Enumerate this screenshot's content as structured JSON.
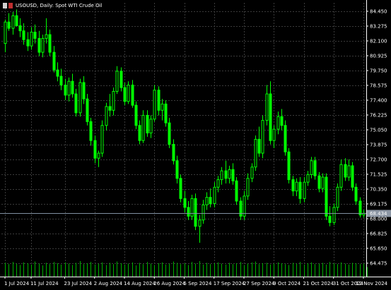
{
  "window": {
    "title": "USOUSD, Daily:  Spot WTI Crude Oil",
    "icon": "chart-window-icon"
  },
  "colors": {
    "background": "#000000",
    "grid": "#3a3a3a",
    "candle": "#00ff00",
    "volume": "#00b000",
    "axis_text": "#ffffff",
    "price_line": "#8090a0",
    "price_tag_bg": "#8c96a4",
    "price_tag_text": "#ffffff"
  },
  "chart_data": {
    "type": "candlestick",
    "symbol": "USOUSD",
    "timeframe": "Daily",
    "title": "USOUSD, Daily:  Spot WTI Crude Oil",
    "grid": true,
    "ylim": [
      63.8,
      85.2
    ],
    "y_ticks": [
      "84.450",
      "83.275",
      "82.100",
      "80.925",
      "79.750",
      "78.575",
      "77.400",
      "76.225",
      "75.050",
      "73.875",
      "72.700",
      "71.525",
      "70.350",
      "69.175",
      "68.000",
      "66.825",
      "65.650",
      "64.475"
    ],
    "x_ticks": [
      "1 Jul 2024",
      "11 Jul 2024",
      "23 Jul 2024",
      "2 Aug 2024",
      "14 Aug 2024",
      "26 Aug 2024",
      "5 Sep 2024",
      "17 Sep 2024",
      "27 Sep 2024",
      "9 Oct 2024",
      "21 Oct 2024",
      "31 Oct 2024",
      "12 Nov 2024"
    ],
    "x_tick_bar_index": [
      0,
      7,
      16,
      24,
      32,
      40,
      48,
      56,
      64,
      72,
      80,
      88,
      96
    ],
    "current_price": "68.434",
    "current_price_value": 68.434,
    "candles": [
      [
        81.9,
        83.8,
        81.2,
        83.6
      ],
      [
        83.6,
        84.3,
        82.9,
        83.1
      ],
      [
        83.1,
        84.4,
        82.6,
        84.1
      ],
      [
        84.1,
        84.6,
        83.4,
        83.3
      ],
      [
        83.3,
        83.9,
        82.4,
        82.9
      ],
      [
        82.9,
        83.5,
        81.8,
        82.2
      ],
      [
        82.2,
        82.8,
        81.3,
        81.7
      ],
      [
        81.7,
        83.2,
        81.4,
        82.8
      ],
      [
        82.8,
        83.4,
        81.9,
        82.3
      ],
      [
        82.3,
        82.9,
        80.9,
        81.2
      ],
      [
        81.2,
        82.6,
        80.8,
        82.3
      ],
      [
        82.3,
        83.9,
        81.9,
        82.6
      ],
      [
        82.6,
        83.0,
        80.9,
        81.2
      ],
      [
        81.2,
        81.7,
        79.6,
        79.8
      ],
      [
        79.8,
        80.4,
        78.9,
        79.3
      ],
      [
        79.3,
        79.9,
        78.2,
        78.6
      ],
      [
        78.6,
        79.1,
        77.4,
        77.8
      ],
      [
        77.8,
        79.2,
        77.3,
        78.9
      ],
      [
        78.9,
        79.5,
        77.6,
        77.9
      ],
      [
        77.9,
        78.3,
        76.1,
        76.4
      ],
      [
        76.4,
        79.1,
        76.1,
        78.8
      ],
      [
        78.8,
        79.3,
        77.1,
        77.5
      ],
      [
        77.5,
        77.9,
        75.4,
        75.7
      ],
      [
        75.7,
        76.0,
        73.8,
        74.2
      ],
      [
        74.2,
        74.6,
        72.4,
        72.8
      ],
      [
        72.8,
        73.4,
        72.1,
        73.2
      ],
      [
        73.2,
        75.8,
        72.9,
        75.4
      ],
      [
        75.4,
        77.2,
        75.0,
        76.9
      ],
      [
        76.9,
        77.9,
        76.1,
        76.6
      ],
      [
        76.6,
        78.4,
        76.2,
        78.1
      ],
      [
        78.1,
        80.1,
        77.9,
        79.7
      ],
      [
        79.7,
        80.0,
        78.1,
        78.4
      ],
      [
        78.4,
        78.8,
        77.0,
        77.3
      ],
      [
        77.3,
        78.9,
        77.1,
        78.6
      ],
      [
        78.6,
        79.0,
        76.8,
        77.0
      ],
      [
        77.0,
        77.3,
        75.1,
        75.4
      ],
      [
        75.4,
        75.8,
        73.9,
        74.2
      ],
      [
        74.2,
        76.6,
        74.0,
        76.2
      ],
      [
        76.2,
        76.6,
        74.5,
        74.8
      ],
      [
        74.8,
        76.2,
        74.4,
        75.9
      ],
      [
        75.9,
        78.6,
        75.7,
        78.2
      ],
      [
        78.2,
        78.5,
        76.2,
        76.6
      ],
      [
        76.6,
        77.5,
        75.8,
        77.1
      ],
      [
        77.1,
        77.4,
        75.3,
        75.6
      ],
      [
        75.6,
        76.0,
        73.6,
        73.9
      ],
      [
        73.9,
        74.3,
        72.3,
        72.6
      ],
      [
        72.6,
        73.0,
        70.8,
        71.2
      ],
      [
        71.2,
        71.5,
        69.3,
        69.6
      ],
      [
        69.6,
        70.2,
        68.5,
        68.9
      ],
      [
        68.9,
        69.4,
        67.9,
        68.2
      ],
      [
        68.2,
        69.9,
        67.9,
        69.6
      ],
      [
        69.6,
        70.0,
        67.1,
        67.4
      ],
      [
        67.4,
        68.3,
        66.1,
        67.9
      ],
      [
        67.9,
        69.5,
        67.6,
        69.1
      ],
      [
        69.1,
        70.1,
        68.7,
        69.7
      ],
      [
        69.7,
        70.4,
        68.9,
        69.2
      ],
      [
        69.2,
        70.9,
        68.9,
        70.5
      ],
      [
        70.5,
        71.4,
        70.1,
        71.1
      ],
      [
        71.1,
        72.1,
        70.7,
        71.8
      ],
      [
        71.8,
        72.6,
        70.8,
        71.2
      ],
      [
        71.2,
        72.2,
        70.8,
        71.9
      ],
      [
        71.9,
        72.4,
        70.7,
        71.0
      ],
      [
        71.0,
        71.3,
        69.1,
        69.4
      ],
      [
        69.4,
        69.7,
        67.9,
        68.2
      ],
      [
        68.2,
        70.2,
        67.9,
        69.8
      ],
      [
        69.8,
        71.6,
        69.5,
        71.2
      ],
      [
        71.2,
        72.4,
        70.9,
        72.1
      ],
      [
        72.1,
        74.6,
        71.8,
        74.3
      ],
      [
        74.3,
        75.3,
        72.9,
        73.2
      ],
      [
        73.2,
        76.2,
        72.8,
        75.8
      ],
      [
        75.8,
        78.6,
        75.4,
        77.9
      ],
      [
        77.9,
        78.9,
        73.9,
        74.2
      ],
      [
        74.2,
        75.4,
        73.6,
        75.1
      ],
      [
        75.1,
        76.5,
        74.7,
        76.1
      ],
      [
        76.1,
        76.7,
        75.0,
        75.4
      ],
      [
        75.4,
        75.8,
        73.0,
        73.3
      ],
      [
        73.3,
        73.6,
        70.8,
        71.1
      ],
      [
        71.1,
        71.4,
        69.8,
        70.2
      ],
      [
        70.2,
        71.2,
        69.8,
        70.9
      ],
      [
        70.9,
        71.3,
        69.2,
        69.6
      ],
      [
        69.6,
        71.3,
        69.3,
        70.9
      ],
      [
        70.9,
        71.8,
        70.6,
        71.5
      ],
      [
        71.5,
        72.9,
        71.2,
        72.6
      ],
      [
        72.6,
        72.9,
        71.1,
        71.4
      ],
      [
        71.4,
        71.7,
        70.1,
        70.4
      ],
      [
        70.4,
        71.6,
        70.1,
        71.3
      ],
      [
        71.3,
        71.6,
        67.9,
        68.2
      ],
      [
        68.2,
        69.0,
        67.4,
        67.7
      ],
      [
        67.7,
        69.2,
        67.5,
        68.9
      ],
      [
        68.9,
        70.8,
        68.6,
        70.5
      ],
      [
        70.5,
        72.7,
        70.2,
        72.3
      ],
      [
        72.3,
        72.8,
        71.0,
        71.3
      ],
      [
        71.3,
        72.7,
        71.0,
        72.2
      ],
      [
        72.2,
        72.5,
        70.2,
        70.5
      ],
      [
        70.5,
        70.8,
        69.1,
        69.4
      ],
      [
        69.4,
        69.7,
        68.1,
        68.3
      ],
      [
        68.3,
        68.7,
        68.1,
        68.43
      ]
    ],
    "volumes": [
      32,
      29,
      34,
      30,
      27,
      33,
      31,
      28,
      35,
      30,
      26,
      32,
      29,
      34,
      31,
      28,
      33,
      30,
      27,
      32,
      36,
      29,
      31,
      34,
      28,
      30,
      33,
      27,
      32,
      29,
      35,
      31,
      28,
      30,
      33,
      26,
      32,
      29,
      34,
      30,
      27,
      31,
      33,
      28,
      30,
      35,
      32,
      29,
      31,
      27,
      34,
      30,
      36,
      28,
      32,
      29,
      31,
      33,
      30,
      28,
      32,
      29,
      31,
      34,
      27,
      30,
      33,
      35,
      29,
      31,
      32,
      28,
      30,
      33,
      31,
      29,
      27,
      32,
      30,
      34,
      28,
      31,
      33,
      29,
      30,
      32,
      28,
      34,
      31,
      29,
      33,
      30,
      28,
      32,
      31,
      29,
      30,
      22
    ]
  }
}
